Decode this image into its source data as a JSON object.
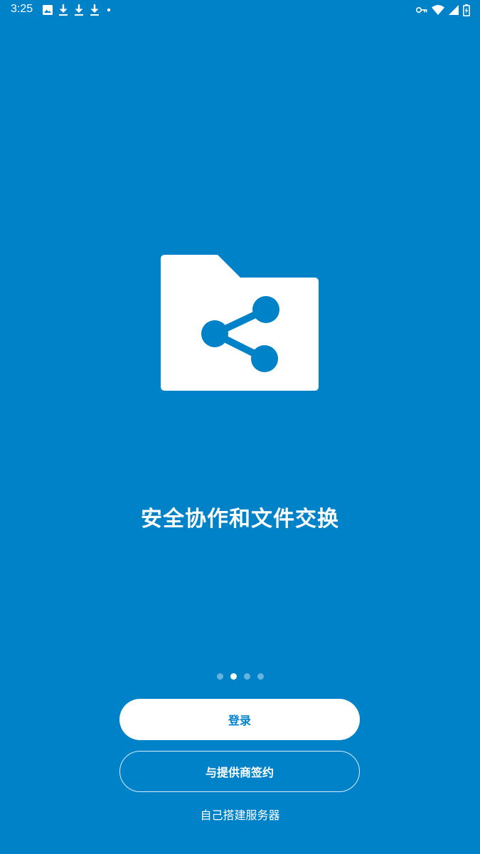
{
  "status_bar": {
    "time": "3:25",
    "left_icons": [
      "image-icon",
      "download-icon",
      "download-icon",
      "download-icon",
      "dot-icon"
    ],
    "right_icons": [
      "vpn-key-icon",
      "wifi-icon",
      "signal-icon",
      "battery-charging-icon"
    ]
  },
  "illustration": {
    "icon": "folder-share-icon"
  },
  "headline": "安全协作和文件交换",
  "pager": {
    "count": 4,
    "active_index": 1
  },
  "buttons": {
    "login_label": "登录",
    "signup_label": "与提供商签约",
    "self_host_label": "自己搭建服务器"
  },
  "colors": {
    "background": "#0082C9",
    "primary_text": "#FFFFFF",
    "button_text": "#0082C9"
  }
}
